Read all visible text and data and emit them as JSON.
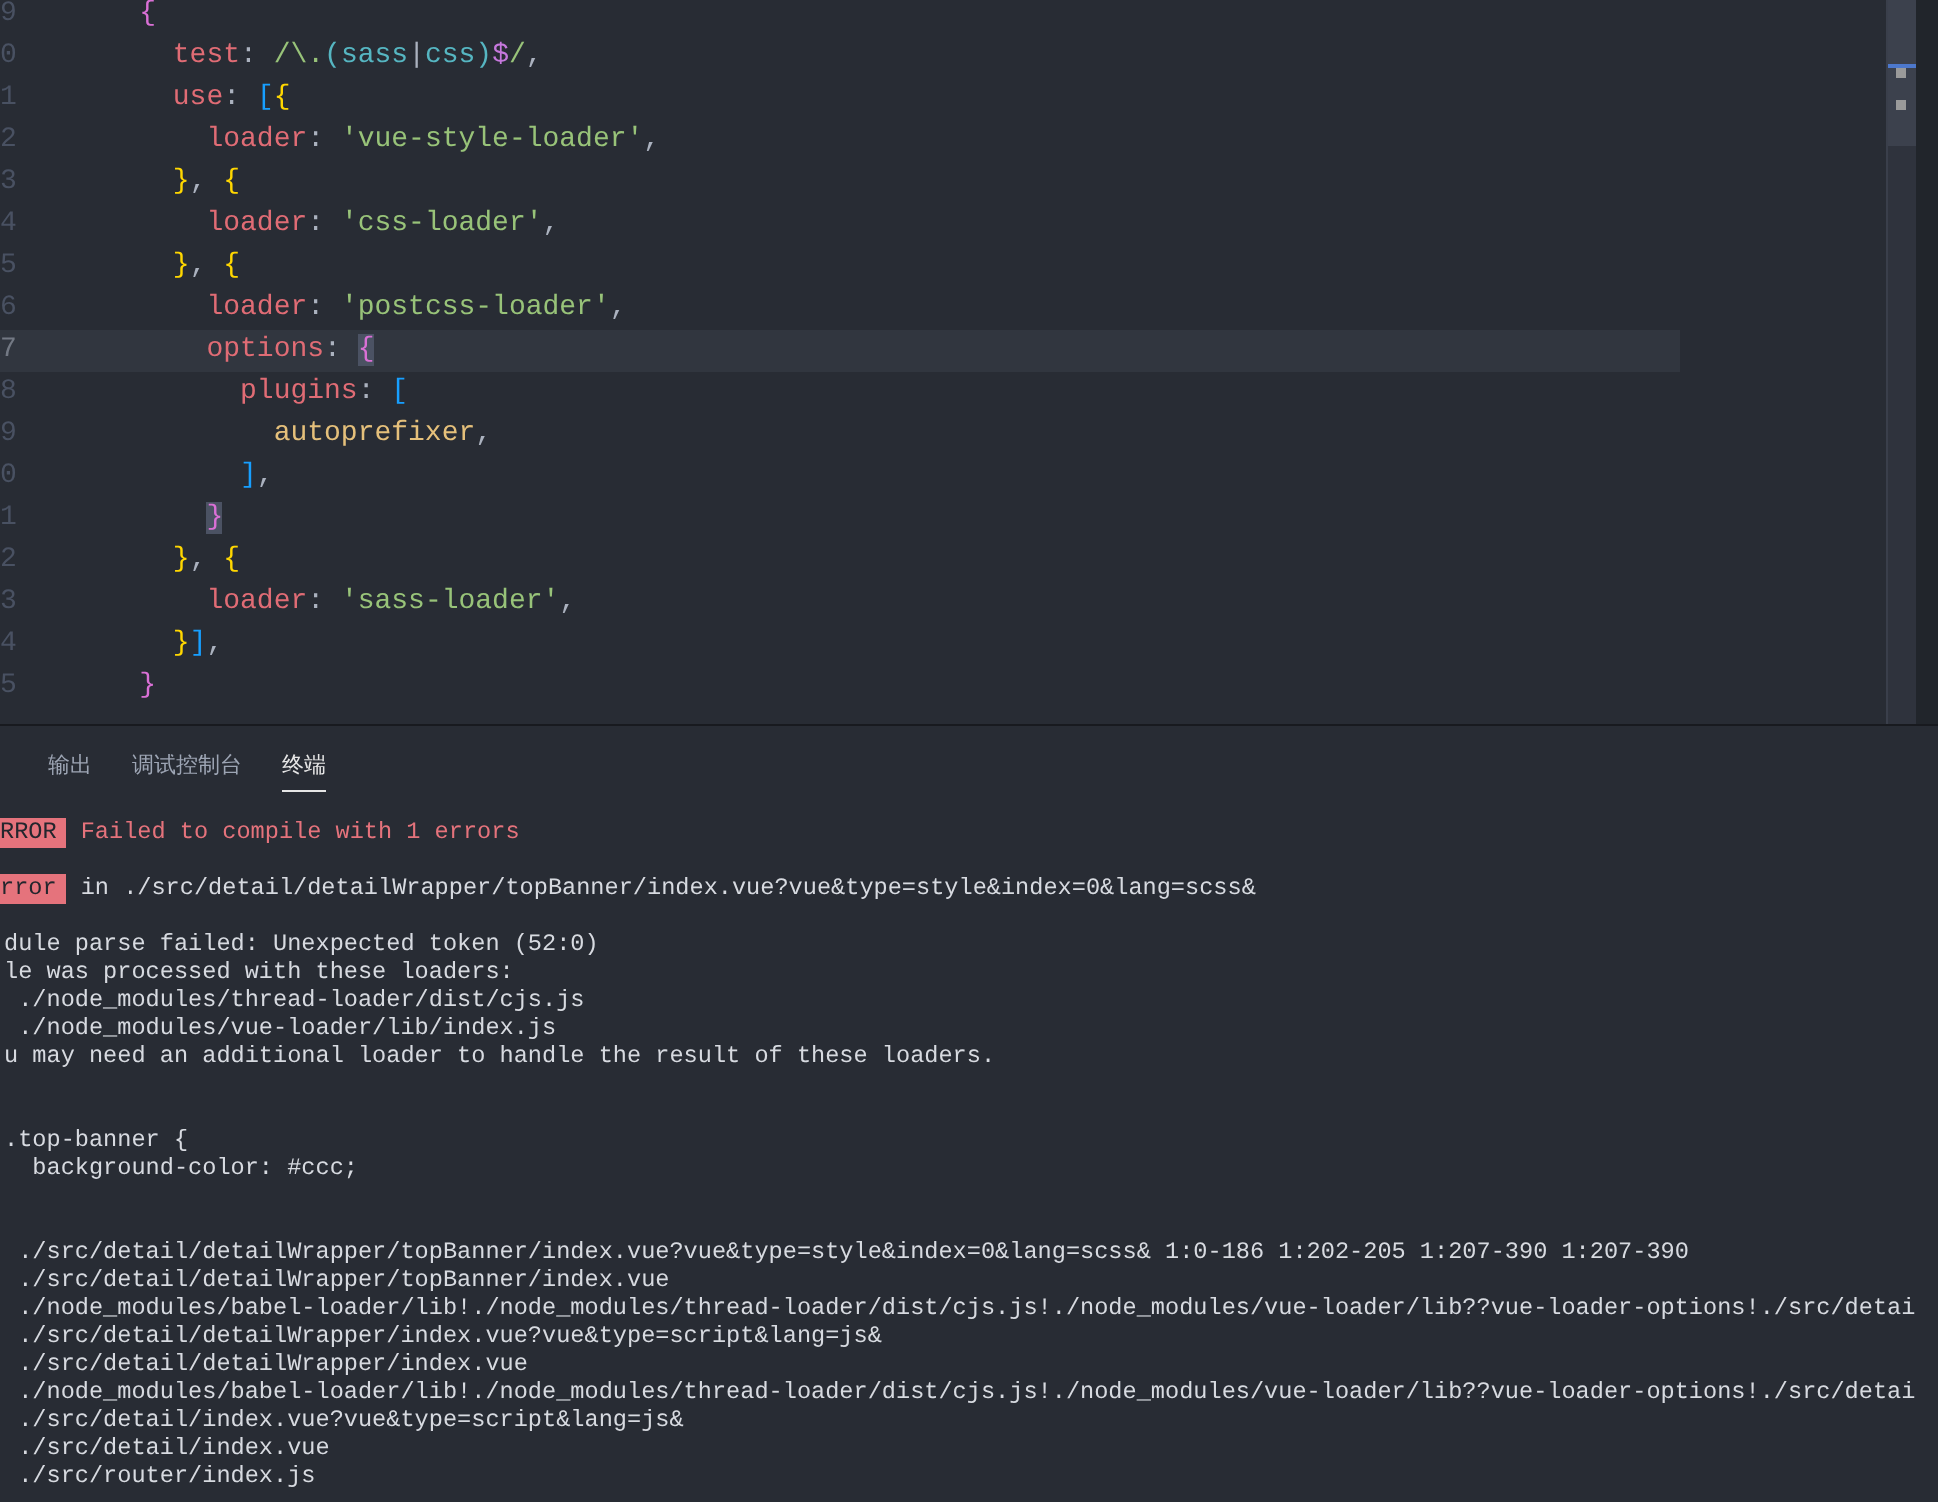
{
  "editor": {
    "lines": [
      {
        "number": "9",
        "current": false,
        "tokens": [
          {
            "text": "    {",
            "kind": "bracket1"
          }
        ]
      },
      {
        "number": "0",
        "current": false,
        "tokens": [
          {
            "text": "      test",
            "kind": "key"
          },
          {
            "text": ": ",
            "kind": "punct"
          },
          {
            "text": "/\\.",
            "kind": "regex"
          },
          {
            "text": "(sass",
            "kind": "group"
          },
          {
            "text": "|",
            "kind": "punct"
          },
          {
            "text": "css)",
            "kind": "group"
          },
          {
            "text": "$",
            "kind": "anchor"
          },
          {
            "text": "/",
            "kind": "regex"
          },
          {
            "text": ",",
            "kind": "punct"
          }
        ]
      },
      {
        "number": "1",
        "current": false,
        "tokens": [
          {
            "text": "      use",
            "kind": "key"
          },
          {
            "text": ": ",
            "kind": "punct"
          },
          {
            "text": "[",
            "kind": "bracket3"
          },
          {
            "text": "{",
            "kind": "bracket2"
          }
        ]
      },
      {
        "number": "2",
        "current": false,
        "tokens": [
          {
            "text": "        loader",
            "kind": "key"
          },
          {
            "text": ": ",
            "kind": "punct"
          },
          {
            "text": "'vue-style-loader'",
            "kind": "string"
          },
          {
            "text": ",",
            "kind": "punct"
          }
        ]
      },
      {
        "number": "3",
        "current": false,
        "tokens": [
          {
            "text": "      }",
            "kind": "bracket2"
          },
          {
            "text": ", ",
            "kind": "punct"
          },
          {
            "text": "{",
            "kind": "bracket2"
          }
        ]
      },
      {
        "number": "4",
        "current": false,
        "tokens": [
          {
            "text": "        loader",
            "kind": "key"
          },
          {
            "text": ": ",
            "kind": "punct"
          },
          {
            "text": "'css-loader'",
            "kind": "string"
          },
          {
            "text": ",",
            "kind": "punct"
          }
        ]
      },
      {
        "number": "5",
        "current": false,
        "tokens": [
          {
            "text": "      }",
            "kind": "bracket2"
          },
          {
            "text": ", ",
            "kind": "punct"
          },
          {
            "text": "{",
            "kind": "bracket2"
          }
        ]
      },
      {
        "number": "6",
        "current": false,
        "tokens": [
          {
            "text": "        loader",
            "kind": "key"
          },
          {
            "text": ": ",
            "kind": "punct"
          },
          {
            "text": "'postcss-loader'",
            "kind": "string"
          },
          {
            "text": ",",
            "kind": "punct"
          }
        ]
      },
      {
        "number": "7",
        "current": true,
        "tokens": [
          {
            "text": "        options",
            "kind": "key"
          },
          {
            "text": ": ",
            "kind": "punct"
          },
          {
            "text": "{",
            "kind": "bracket-match"
          }
        ]
      },
      {
        "number": "8",
        "current": false,
        "tokens": [
          {
            "text": "          plugins",
            "kind": "key"
          },
          {
            "text": ": ",
            "kind": "punct"
          },
          {
            "text": "[",
            "kind": "bracket3"
          }
        ]
      },
      {
        "number": "9",
        "current": false,
        "tokens": [
          {
            "text": "            autoprefixer",
            "kind": "ident"
          },
          {
            "text": ",",
            "kind": "punct"
          }
        ]
      },
      {
        "number": "0",
        "current": false,
        "tokens": [
          {
            "text": "          ]",
            "kind": "bracket3"
          },
          {
            "text": ",",
            "kind": "punct"
          }
        ]
      },
      {
        "number": "1",
        "current": false,
        "tokens": [
          {
            "text": "        }",
            "kind": "bracket-match"
          }
        ]
      },
      {
        "number": "2",
        "current": false,
        "tokens": [
          {
            "text": "      }",
            "kind": "bracket2"
          },
          {
            "text": ", ",
            "kind": "punct"
          },
          {
            "text": "{",
            "kind": "bracket2"
          }
        ]
      },
      {
        "number": "3",
        "current": false,
        "tokens": [
          {
            "text": "        loader",
            "kind": "key"
          },
          {
            "text": ": ",
            "kind": "punct"
          },
          {
            "text": "'sass-loader'",
            "kind": "string"
          },
          {
            "text": ",",
            "kind": "punct"
          }
        ]
      },
      {
        "number": "4",
        "current": false,
        "tokens": [
          {
            "text": "      }",
            "kind": "bracket2"
          },
          {
            "text": "]",
            "kind": "bracket3"
          },
          {
            "text": ",",
            "kind": "punct"
          }
        ]
      },
      {
        "number": "5",
        "current": false,
        "tokens": [
          {
            "text": "    }",
            "kind": "bracket1"
          }
        ]
      }
    ]
  },
  "panel": {
    "tabs": [
      {
        "label": "输出",
        "selected": false
      },
      {
        "label": "调试控制台",
        "selected": false
      },
      {
        "label": "终端",
        "selected": true
      }
    ],
    "terminal": [
      {
        "kind": "badge-error",
        "badge": "RROR",
        "text": "Failed to compile with 1 errors"
      },
      {
        "kind": "blank"
      },
      {
        "kind": "badge",
        "badge": "rror",
        "text": "in ./src/detail/detailWrapper/topBanner/index.vue?vue&type=style&index=0&lang=scss&"
      },
      {
        "kind": "blank"
      },
      {
        "kind": "text",
        "text": "dule parse failed: Unexpected token (52:0)"
      },
      {
        "kind": "text",
        "text": "le was processed with these loaders:"
      },
      {
        "kind": "text",
        "text": " ./node_modules/thread-loader/dist/cjs.js"
      },
      {
        "kind": "text",
        "text": " ./node_modules/vue-loader/lib/index.js"
      },
      {
        "kind": "text",
        "text": "u may need an additional loader to handle the result of these loaders."
      },
      {
        "kind": "blank"
      },
      {
        "kind": "blank"
      },
      {
        "kind": "text",
        "text": ".top-banner {"
      },
      {
        "kind": "text",
        "text": "  background-color: #ccc;"
      },
      {
        "kind": "blank"
      },
      {
        "kind": "blank"
      },
      {
        "kind": "text",
        "text": " ./src/detail/detailWrapper/topBanner/index.vue?vue&type=style&index=0&lang=scss& 1:0-186 1:202-205 1:207-390 1:207-390"
      },
      {
        "kind": "text",
        "text": " ./src/detail/detailWrapper/topBanner/index.vue"
      },
      {
        "kind": "text",
        "text": " ./node_modules/babel-loader/lib!./node_modules/thread-loader/dist/cjs.js!./node_modules/vue-loader/lib??vue-loader-options!./src/detai"
      },
      {
        "kind": "text",
        "text": " ./src/detail/detailWrapper/index.vue?vue&type=script&lang=js&"
      },
      {
        "kind": "text",
        "text": " ./src/detail/detailWrapper/index.vue"
      },
      {
        "kind": "text",
        "text": " ./node_modules/babel-loader/lib!./node_modules/thread-loader/dist/cjs.js!./node_modules/vue-loader/lib??vue-loader-options!./src/detai"
      },
      {
        "kind": "text",
        "text": " ./src/detail/index.vue?vue&type=script&lang=js&"
      },
      {
        "kind": "text",
        "text": " ./src/detail/index.vue"
      },
      {
        "kind": "text",
        "text": " ./src/router/index.js"
      }
    ]
  }
}
